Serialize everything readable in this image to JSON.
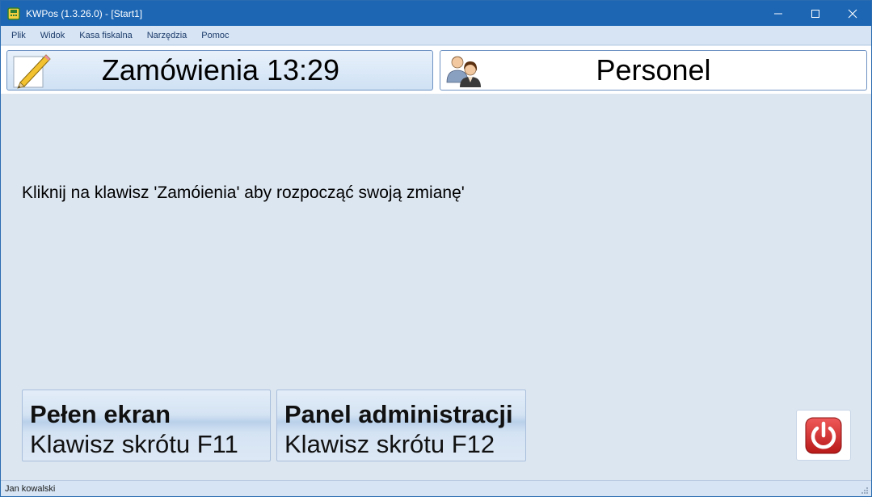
{
  "window": {
    "title": "KWPos  (1.3.26.0) - [Start1]"
  },
  "menu": {
    "items": [
      "Plik",
      "Widok",
      "Kasa fiskalna",
      "Narzędzia",
      "Pomoc"
    ]
  },
  "top_buttons": {
    "orders_label": "Zamówienia 13:29",
    "orders_icon": "pencil-icon",
    "staff_label": "Personel",
    "staff_icon": "people-icon"
  },
  "main": {
    "message": "Kliknij na klawisz 'Zamóienia' aby rozpocząć swoją zmianę'"
  },
  "bottom_buttons": {
    "fullscreen_title": "Pełen ekran",
    "fullscreen_shortcut": "Klawisz skrótu F11",
    "admin_title": "Panel administracji",
    "admin_shortcut": "Klawisz skrótu F12",
    "power_icon": "power-icon"
  },
  "status": {
    "user": "Jan kowalski"
  },
  "colors": {
    "titlebar": "#1c66b4",
    "background": "#dce6f1",
    "power": "#d92b2b"
  }
}
